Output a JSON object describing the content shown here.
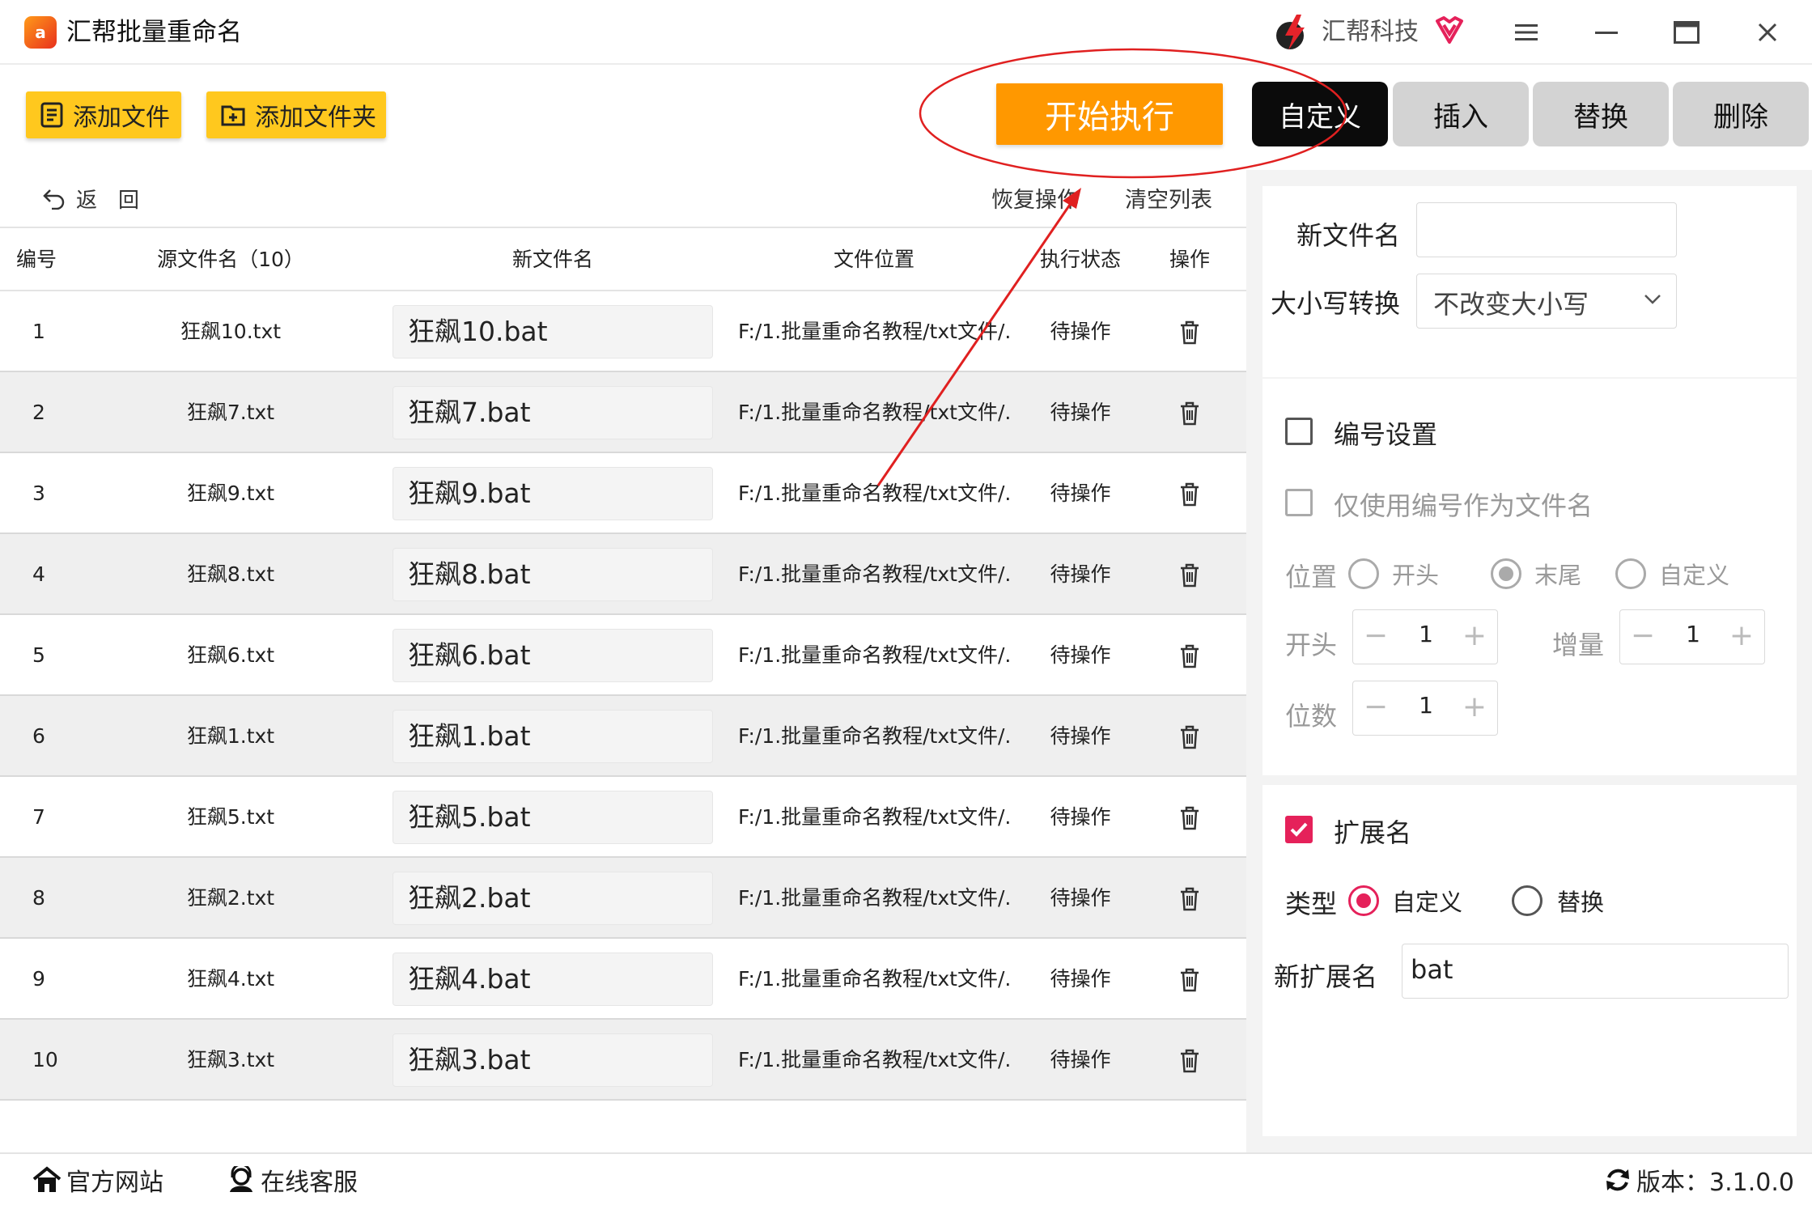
{
  "titlebar": {
    "app_title": "汇帮批量重命名",
    "app_logo_text": "a",
    "brand_name": "汇帮科技",
    "icons": [
      "brand-logo-icon",
      "vip-heart-icon",
      "menu-icon",
      "minimize-icon",
      "maximize-icon",
      "close-icon"
    ]
  },
  "toolbar": {
    "add_file_label": "添加文件",
    "add_folder_label": "添加文件夹",
    "start_label": "开始执行",
    "tabs": [
      {
        "label": "自定义",
        "active": true
      },
      {
        "label": "插入",
        "active": false
      },
      {
        "label": "替换",
        "active": false
      },
      {
        "label": "删除",
        "active": false
      }
    ]
  },
  "subtoolbar": {
    "back_label": "返　回",
    "restore_label": "恢复操作",
    "clear_label": "清空列表"
  },
  "table": {
    "headers": {
      "index": "编号",
      "source": "源文件名（10）",
      "new_name": "新文件名",
      "location": "文件位置",
      "status": "执行状态",
      "action": "操作"
    },
    "rows": [
      {
        "index": "1",
        "source": "狂飙10.txt",
        "new_name": "狂飙10.bat",
        "location": "F:/1.批量重命名教程/txt文件/...",
        "status": "待操作"
      },
      {
        "index": "2",
        "source": "狂飙7.txt",
        "new_name": "狂飙7.bat",
        "location": "F:/1.批量重命名教程/txt文件/...",
        "status": "待操作"
      },
      {
        "index": "3",
        "source": "狂飙9.txt",
        "new_name": "狂飙9.bat",
        "location": "F:/1.批量重命名教程/txt文件/...",
        "status": "待操作"
      },
      {
        "index": "4",
        "source": "狂飙8.txt",
        "new_name": "狂飙8.bat",
        "location": "F:/1.批量重命名教程/txt文件/...",
        "status": "待操作"
      },
      {
        "index": "5",
        "source": "狂飙6.txt",
        "new_name": "狂飙6.bat",
        "location": "F:/1.批量重命名教程/txt文件/...",
        "status": "待操作"
      },
      {
        "index": "6",
        "source": "狂飙1.txt",
        "new_name": "狂飙1.bat",
        "location": "F:/1.批量重命名教程/txt文件/...",
        "status": "待操作"
      },
      {
        "index": "7",
        "source": "狂飙5.txt",
        "new_name": "狂飙5.bat",
        "location": "F:/1.批量重命名教程/txt文件/...",
        "status": "待操作"
      },
      {
        "index": "8",
        "source": "狂飙2.txt",
        "new_name": "狂飙2.bat",
        "location": "F:/1.批量重命名教程/txt文件/...",
        "status": "待操作"
      },
      {
        "index": "9",
        "source": "狂飙4.txt",
        "new_name": "狂飙4.bat",
        "location": "F:/1.批量重命名教程/txt文件/...",
        "status": "待操作"
      },
      {
        "index": "10",
        "source": "狂飙3.txt",
        "new_name": "狂飙3.bat",
        "location": "F:/1.批量重命名教程/txt文件/...",
        "status": "待操作"
      }
    ]
  },
  "panel": {
    "new_name_label": "新文件名",
    "new_name_value": "",
    "case_label": "大小写转换",
    "case_value": "不改变大小写",
    "numbering_label": "编号设置",
    "numbering_checked": false,
    "only_number_label": "仅使用编号作为文件名",
    "position_label": "位置",
    "position_options": [
      "开头",
      "末尾",
      "自定义"
    ],
    "position_selected": "末尾",
    "start_label": "开头",
    "start_value": "1",
    "increment_label": "增量",
    "increment_value": "1",
    "digits_label": "位数",
    "digits_value": "1",
    "minus_symbol": "−",
    "plus_symbol": "+",
    "extension_label": "扩展名",
    "extension_checked": true,
    "type_label": "类型",
    "type_options": [
      "自定义",
      "替换"
    ],
    "type_selected": "自定义",
    "new_ext_label": "新扩展名",
    "new_ext_value": "bat"
  },
  "bottombar": {
    "website_label": "官方网站",
    "support_label": "在线客服",
    "version_label": "版本：3.1.0.0"
  },
  "colors": {
    "accent_orange": "#ff9800",
    "button_yellow": "#ffc81e",
    "check_pink": "#e5215a",
    "annotation_red": "#e02020"
  }
}
